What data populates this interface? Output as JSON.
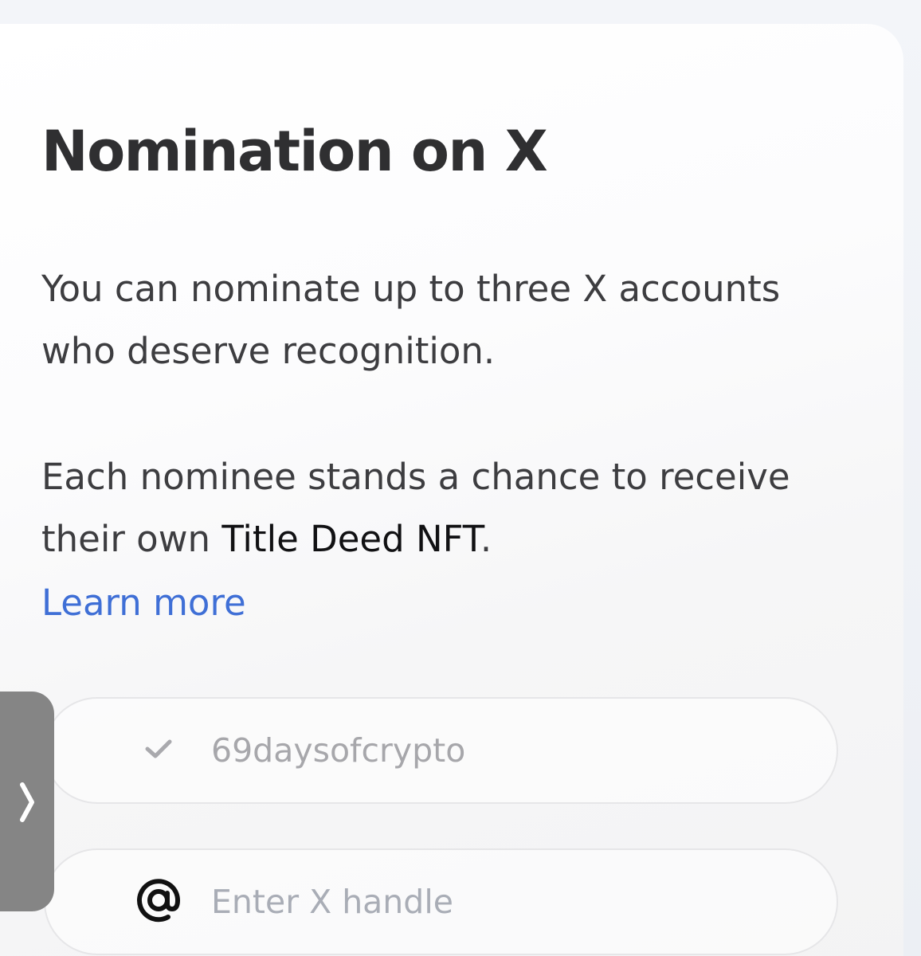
{
  "card": {
    "title": "Nomination on X",
    "description_1": "You can nominate up to three X accounts who deserve recognition.",
    "description_2_prefix": "Each nominee stands a chance to receive their own ",
    "description_2_highlight": "Title Deed NFT",
    "description_2_suffix": ".",
    "learn_more_label": "Learn more"
  },
  "nominees": [
    {
      "status_icon": "check-icon",
      "handle": "69daysofcrypto"
    },
    {
      "status_icon": "at-icon",
      "placeholder": "Enter X handle",
      "value": ""
    }
  ],
  "side_toggle": {
    "icon": "chevron-right-icon"
  },
  "colors": {
    "link": "#3f6fd6",
    "title": "#2f2f31",
    "body_text": "#3d3d40",
    "muted_text": "#a7a7ab",
    "handle_bg": "#858585"
  }
}
